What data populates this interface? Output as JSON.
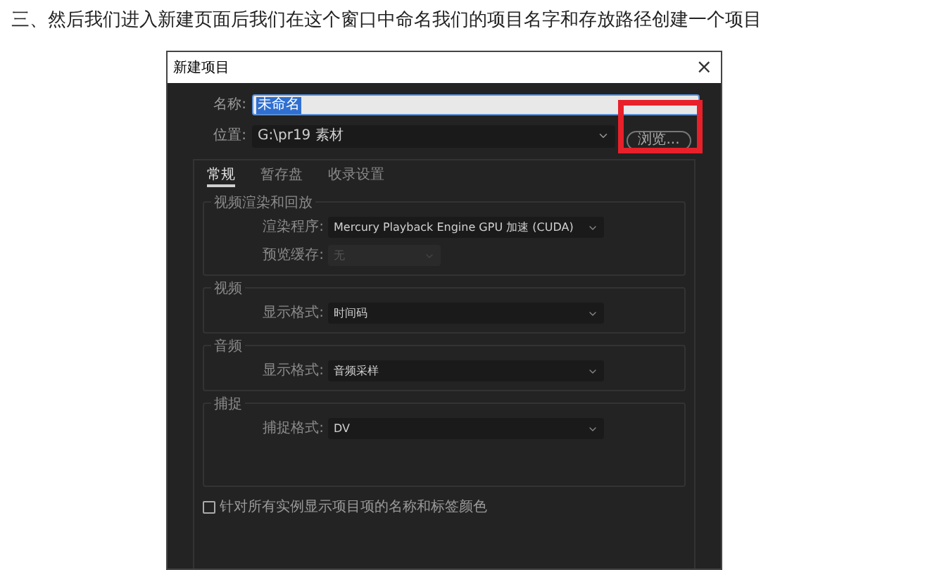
{
  "heading": "三、然后我们进入新建页面后我们在这个窗口中命名我们的项目名字和存放路径创建一个项目",
  "dialog": {
    "title": "新建项目",
    "close": "×",
    "name_field": {
      "label": "名称:",
      "value": "未命名",
      "text_selected": true
    },
    "location_field": {
      "label": "位置:",
      "value": "G:\\pr19 素材"
    },
    "browse_button": {
      "label": "浏览...",
      "highlighted": true
    },
    "tabs": [
      {
        "label": "常规",
        "selected": true
      },
      {
        "label": "暂存盘",
        "selected": false
      },
      {
        "label": "收录设置",
        "selected": false
      }
    ],
    "sections": [
      {
        "title": "视频渲染和回放",
        "rows": [
          {
            "label": "渲染程序:",
            "value": "Mercury Playback Engine GPU 加速 (CUDA)",
            "disabled": false,
            "wide": true
          },
          {
            "label": "预览缓存:",
            "value": "无",
            "disabled": true,
            "wide": false
          }
        ],
        "tall": false
      },
      {
        "title": "视频",
        "rows": [
          {
            "label": "显示格式:",
            "value": "时间码",
            "disabled": false,
            "wide": true
          }
        ],
        "tall": false
      },
      {
        "title": "音频",
        "rows": [
          {
            "label": "显示格式:",
            "value": "音频采样",
            "disabled": false,
            "wide": true
          }
        ],
        "tall": false
      },
      {
        "title": "捕捉",
        "rows": [
          {
            "label": "捕捉格式:",
            "value": "DV",
            "disabled": false,
            "wide": true
          }
        ],
        "tall": true
      }
    ],
    "checkbox": {
      "label": "针对所有实例显示项目项的名称和标签颜色",
      "checked": false
    }
  }
}
